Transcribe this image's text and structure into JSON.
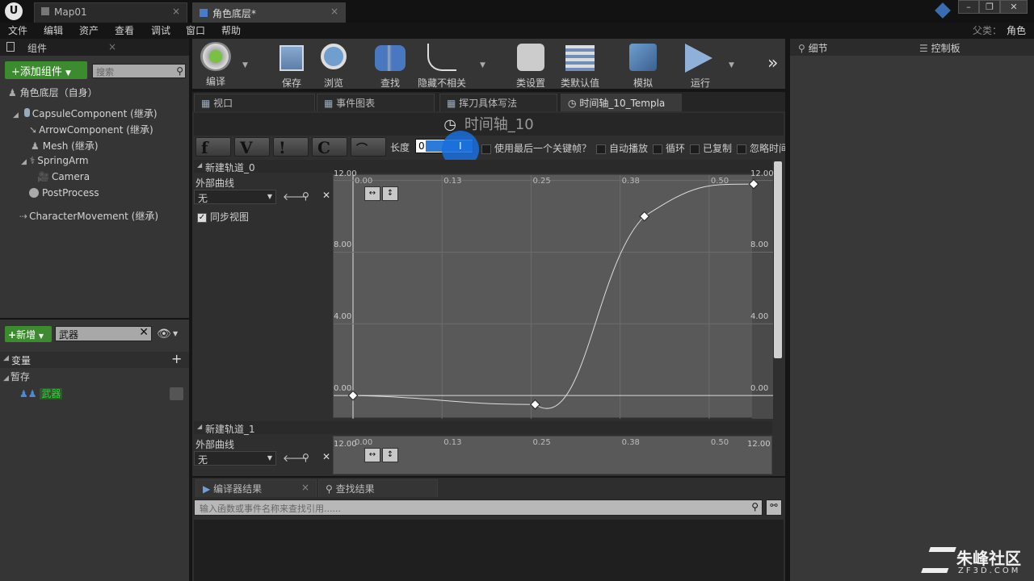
{
  "tabs": [
    {
      "label": "Map01"
    },
    {
      "label": "角色底层*"
    }
  ],
  "menu": [
    "文件",
    "编辑",
    "资产",
    "查看",
    "调试",
    "窗口",
    "帮助"
  ],
  "parent": {
    "label": "父类：",
    "value": "角色"
  },
  "components": {
    "title": "组件",
    "add_button": "+添加组件",
    "search_placeholder": "搜索",
    "root": "角色底层（自身）",
    "items": [
      "CapsuleComponent (继承)",
      "ArrowComponent (继承)",
      "Mesh (继承)",
      "SpringArm",
      "Camera",
      "PostProcess",
      "CharacterMovement (继承)"
    ]
  },
  "mybp": {
    "new_button": "新增",
    "filter_value": "武器",
    "variables": "变量",
    "temp": "暂存",
    "var_item": "武器"
  },
  "toolbar": [
    "编译",
    "保存",
    "浏览",
    "查找",
    "隐藏不相关",
    "类设置",
    "类默认值",
    "模拟",
    "运行"
  ],
  "details": {
    "title": "细节",
    "palette": "控制板"
  },
  "editor_tabs": [
    "视口",
    "事件图表",
    "挥刀具体写法",
    "时间轴_10_Templa"
  ],
  "timeline": {
    "title": "时间轴_10",
    "length_label": "长度",
    "length_value": "0",
    "checkboxes": [
      "使用最后一个关键帧？",
      "自动播放",
      "循环",
      "已复制",
      "忽略时间"
    ],
    "track0": {
      "name": "新建轨道_0",
      "external": "外部曲线",
      "select": "无",
      "sync": "同步视图"
    },
    "track1": {
      "name": "新建轨道_1",
      "external": "外部曲线",
      "select": "无"
    },
    "x_ticks": [
      "0.00",
      "0.13",
      "0.25",
      "0.38",
      "0.50"
    ],
    "y_ticks": [
      "12.00",
      "8.00",
      "4.00",
      "0.00"
    ],
    "y_ticks2": [
      "12.00"
    ]
  },
  "bottom": {
    "tabs": [
      "编译器结果",
      "查找结果"
    ],
    "search_placeholder": "输入函数或事件名称来查找引用......"
  },
  "watermark": {
    "brand": "朱峰社区",
    "url": "ZF3D.COM"
  },
  "chart_data": {
    "type": "line",
    "title": "",
    "x": [
      0.0,
      0.25,
      0.4,
      0.55
    ],
    "series": [
      {
        "values": [
          0.0,
          -0.5,
          10.0,
          11.8
        ]
      }
    ],
    "xlim": [
      0.0,
      0.55
    ],
    "ylim": [
      -1.3,
      12.3
    ]
  }
}
